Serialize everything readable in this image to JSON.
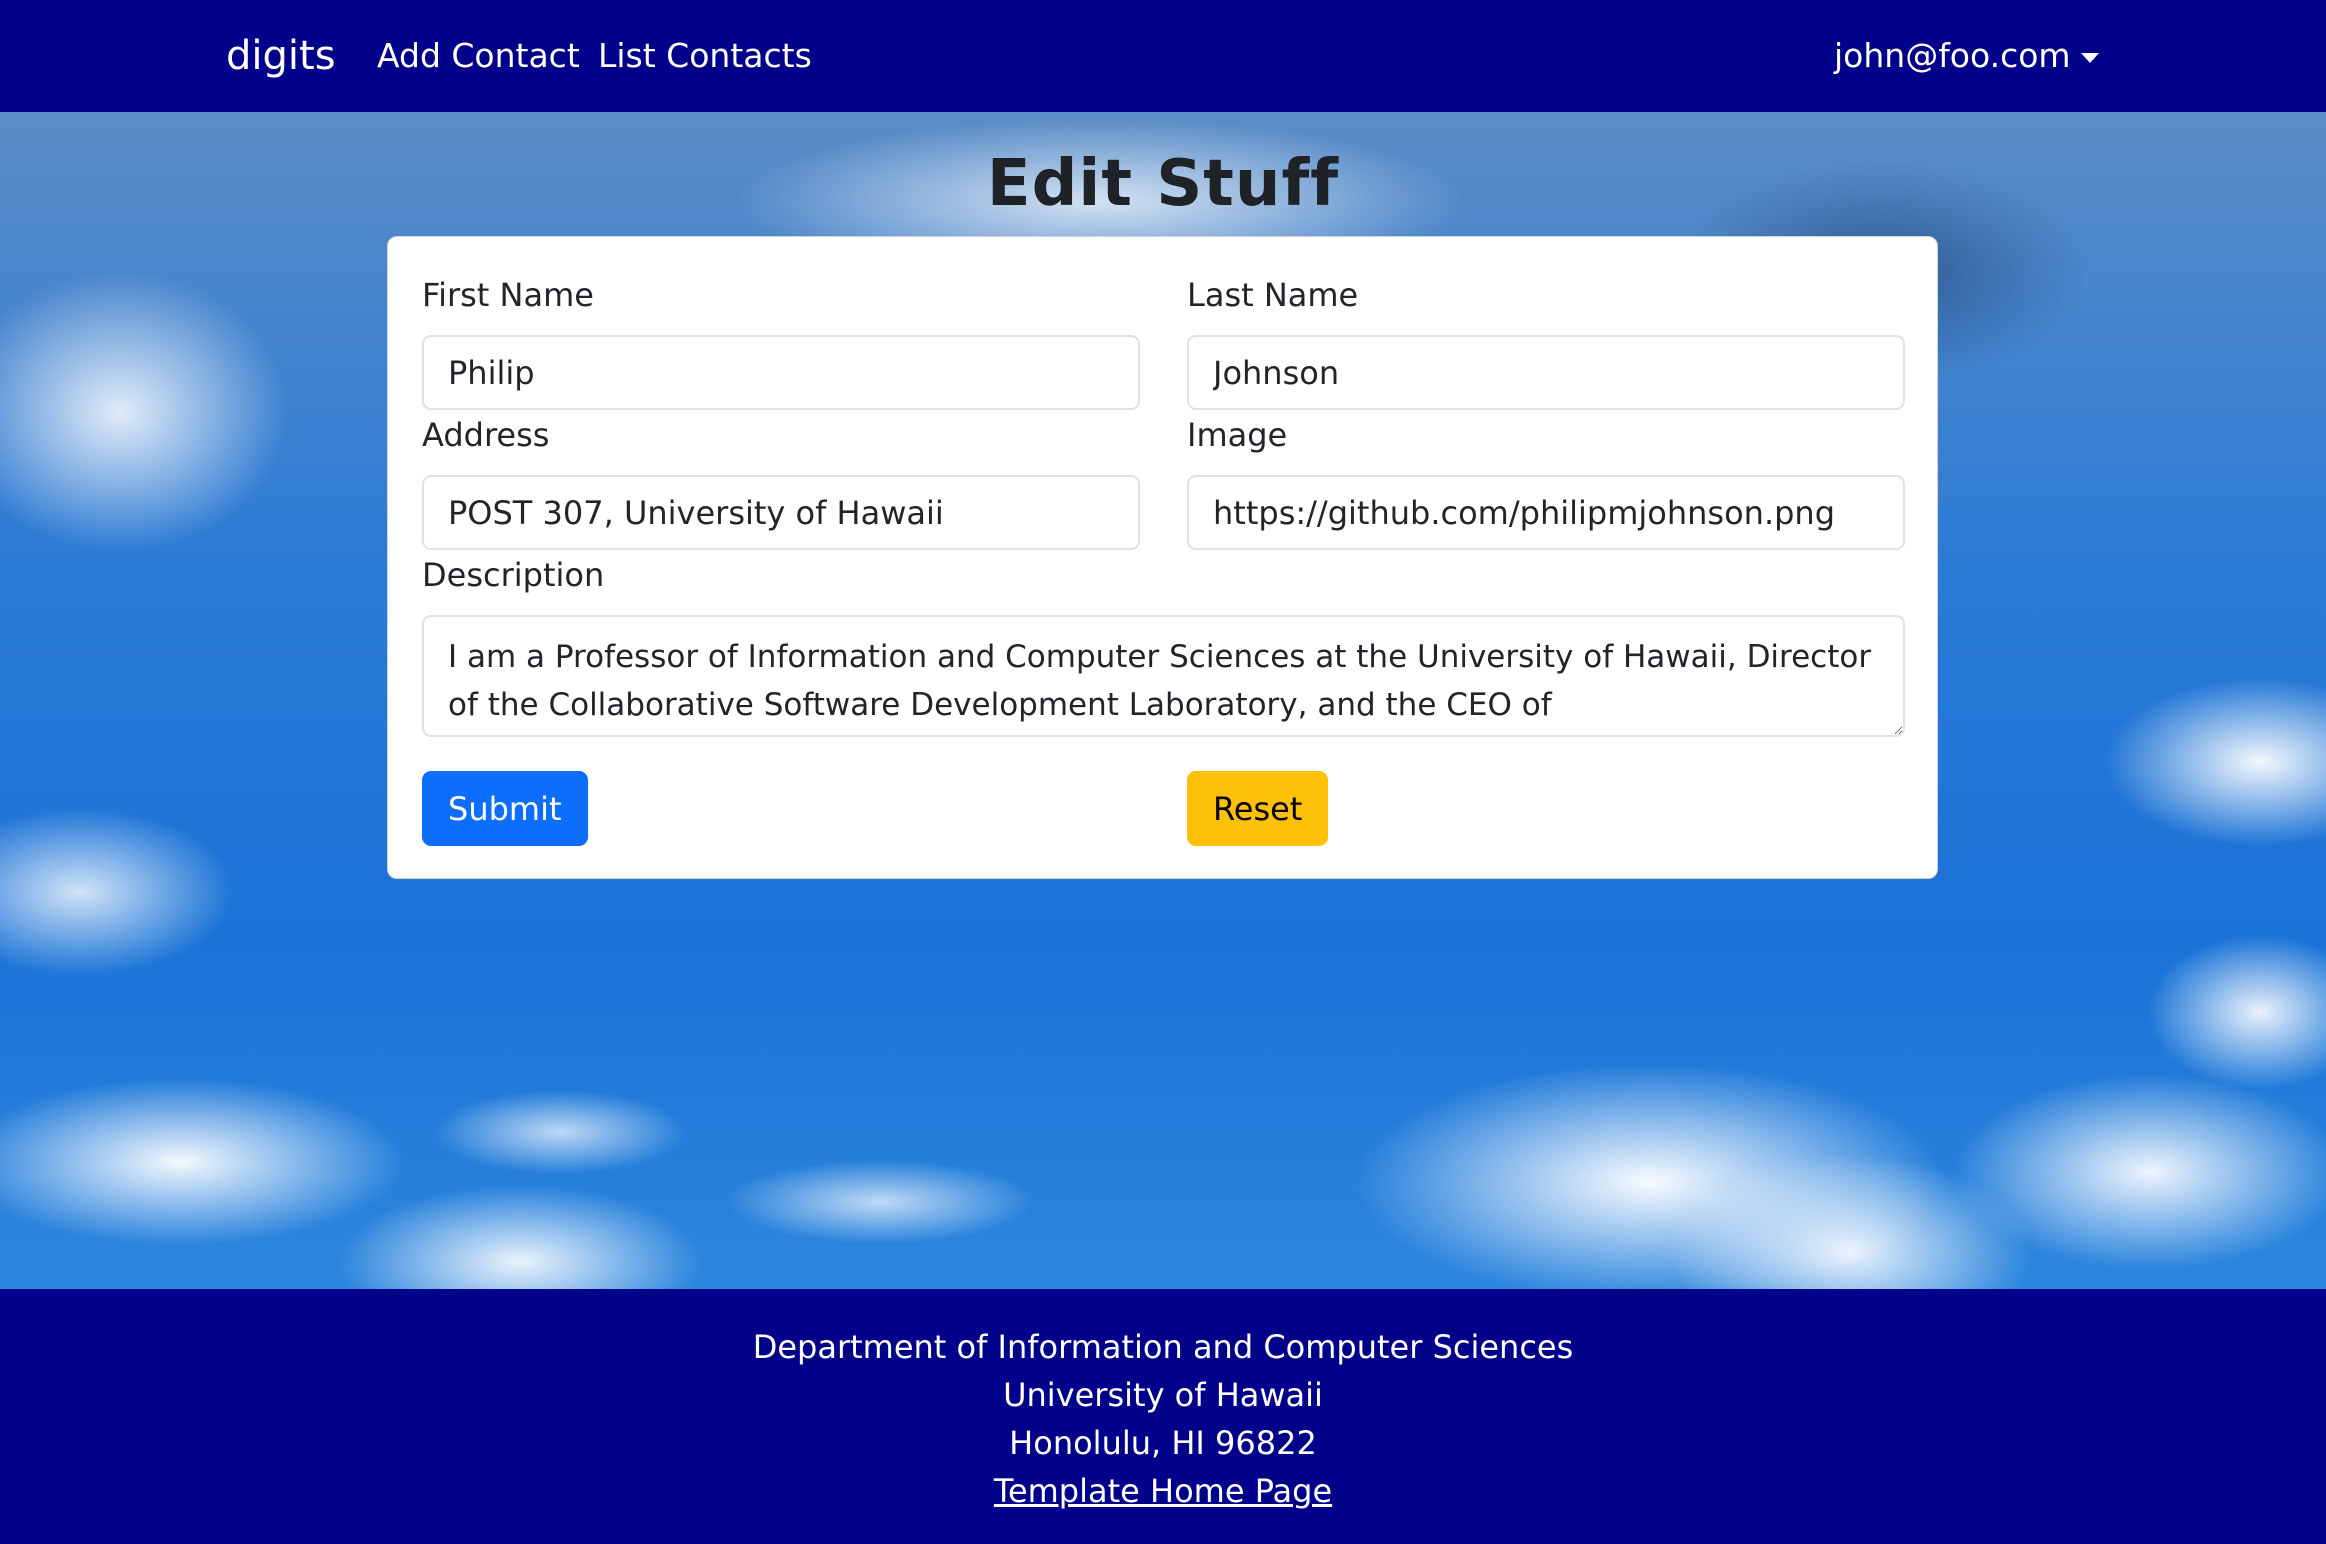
{
  "navbar": {
    "brand": "digits",
    "links": [
      "Add Contact",
      "List Contacts"
    ],
    "user": "john@foo.com"
  },
  "page": {
    "title": "Edit Stuff"
  },
  "form": {
    "first_name": {
      "label": "First Name",
      "value": "Philip"
    },
    "last_name": {
      "label": "Last Name",
      "value": "Johnson"
    },
    "address": {
      "label": "Address",
      "value": "POST 307, University of Hawaii"
    },
    "image": {
      "label": "Image",
      "value": "https://github.com/philipmjohnson.png"
    },
    "description": {
      "label": "Description",
      "value": "I am a Professor of Information and Computer Sciences at the University of Hawaii, Director of the Collaborative Software Development Laboratory, and the CEO of OpenPowerQuality.com."
    },
    "submit_label": "Submit",
    "reset_label": "Reset"
  },
  "footer": {
    "lines": [
      "Department of Information and Computer Sciences",
      "University of Hawaii",
      "Honolulu, HI 96822"
    ],
    "link": "Template Home Page"
  },
  "colors": {
    "navbar_bg": "#01018a",
    "primary": "#0d6efd",
    "warning": "#ffc107"
  },
  "icons": {
    "user_menu": "caret-down-icon"
  }
}
